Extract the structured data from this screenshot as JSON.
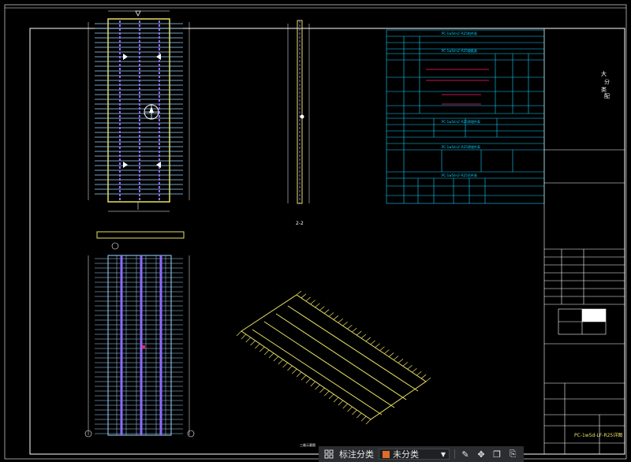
{
  "colors": {
    "frame": "#ffffff",
    "panel_outline": "#e8e061",
    "rebar": "#9fd7ff",
    "strand": "#8d6cff",
    "table": "#10d3ff",
    "highlight": "#ff1f6b",
    "toolbar_bg": "#2b2d31",
    "category_swatch": "#e06c2a"
  },
  "drawing": {
    "title_block": {
      "project_text": "大分类配",
      "drawing_name": "PC-1w5d-LF-R25详图",
      "section_label": "2-2",
      "iso_label": "三维示意图"
    },
    "table": {
      "header1": "PC-1w5d-LF-R25构件表",
      "header2": "PC-1w5d-LF-R25钢筋表",
      "header3": "PC-1w5d-LF-R25预埋件表",
      "header4": "PC-1w5d-LF-R25预埋件表",
      "header5": "PC-1w5d-LF-R25吊件表"
    }
  },
  "toolbar": {
    "grid_icon": "grid-icon",
    "annotate_label": "标注分类",
    "category_value": "未分类",
    "icons": [
      "edit-icon",
      "move-icon",
      "copy-icon",
      "paste-icon"
    ]
  }
}
